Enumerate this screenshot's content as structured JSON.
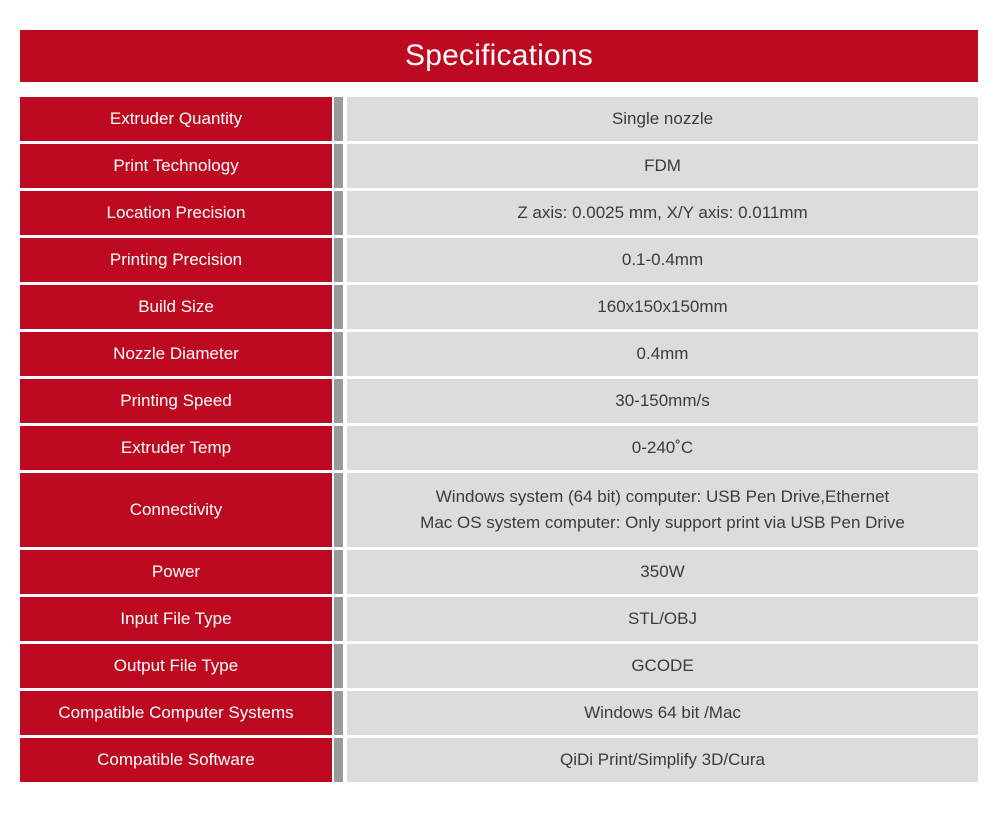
{
  "header": {
    "title": "Specifications"
  },
  "colors": {
    "accent_red": "#bd0a20",
    "value_gray": "#dcdcdc",
    "divider_gray": "#9a9a9a",
    "title_text": "#ffffff",
    "value_text": "#3b3b3b",
    "page_background": "#ffffff"
  },
  "table": {
    "rows": [
      {
        "label": "Extruder Quantity",
        "lines": [
          "Single nozzle"
        ]
      },
      {
        "label": "Print Technology",
        "lines": [
          "FDM"
        ]
      },
      {
        "label": "Location Precision",
        "lines": [
          "Z axis: 0.0025 mm, X/Y axis: 0.011mm"
        ]
      },
      {
        "label": "Printing Precision",
        "lines": [
          "0.1-0.4mm"
        ]
      },
      {
        "label": "Build Size",
        "lines": [
          "160x150x150mm"
        ]
      },
      {
        "label": "Nozzle Diameter",
        "lines": [
          "0.4mm"
        ]
      },
      {
        "label": "Printing Speed",
        "lines": [
          "30-150mm/s"
        ]
      },
      {
        "label": "Extruder Temp",
        "lines": [
          "0-240˚C"
        ]
      },
      {
        "label": "Connectivity",
        "lines": [
          "Windows system (64 bit) computer: USB Pen Drive,Ethernet",
          "Mac OS system computer: Only support print via USB Pen Drive"
        ]
      },
      {
        "label": "Power",
        "lines": [
          "350W"
        ]
      },
      {
        "label": "Input File Type",
        "lines": [
          "STL/OBJ"
        ]
      },
      {
        "label": "Output File Type",
        "lines": [
          "GCODE"
        ]
      },
      {
        "label": "Compatible Computer Systems",
        "lines": [
          "Windows 64 bit /Mac"
        ]
      },
      {
        "label": "Compatible Software",
        "lines": [
          "QiDi Print/Simplify 3D/Cura"
        ]
      }
    ]
  }
}
